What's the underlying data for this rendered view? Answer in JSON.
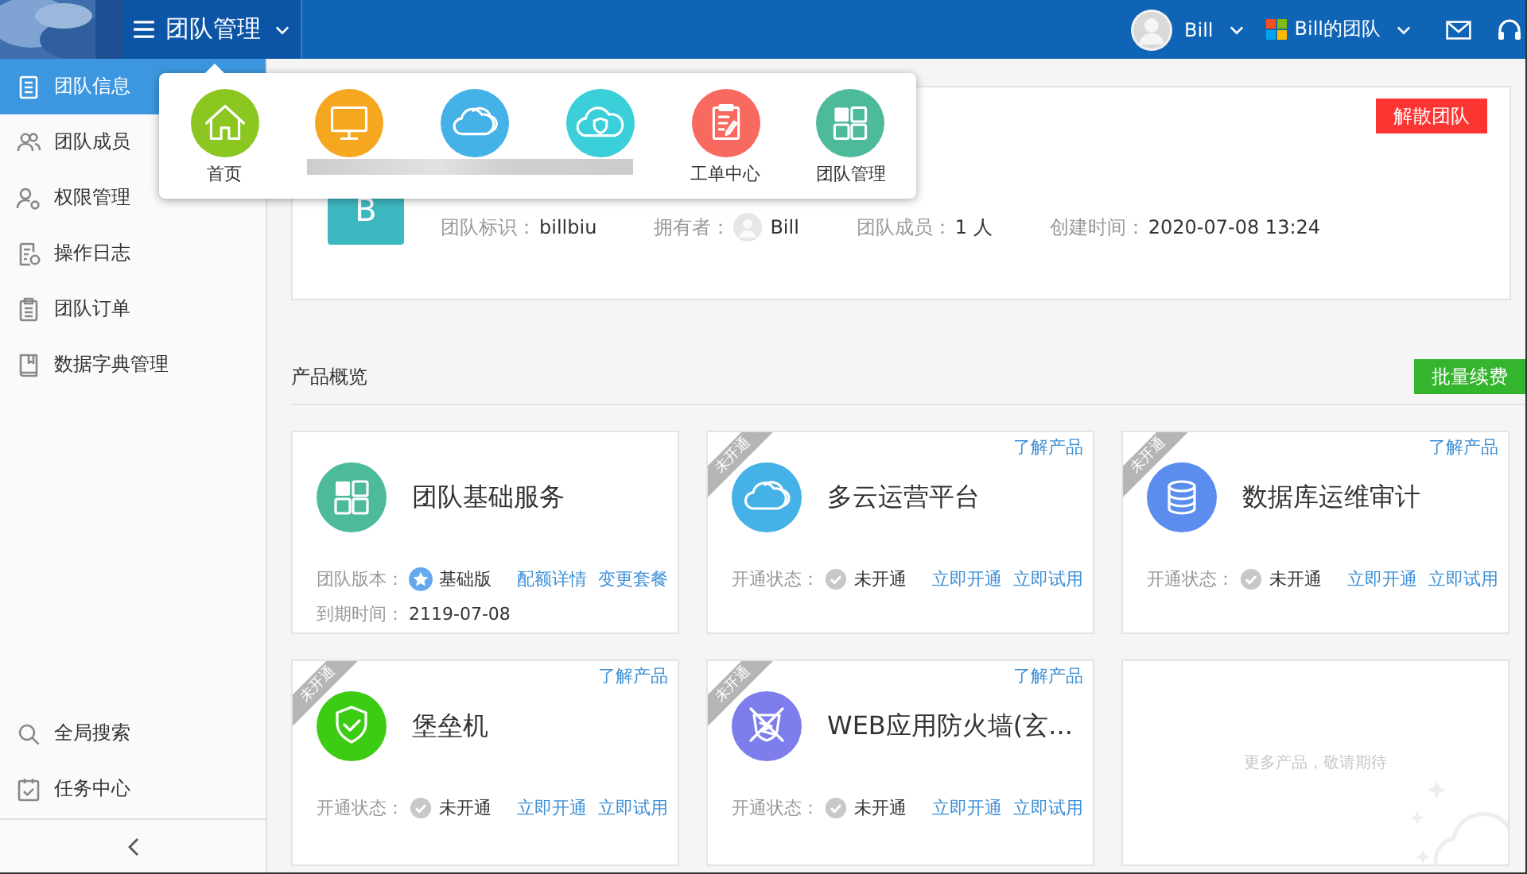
{
  "topbar": {
    "menu_title": "团队管理",
    "user": "Bill",
    "team": "Bill的团队"
  },
  "sidebar": {
    "items": [
      {
        "label": "团队信息",
        "selected": true
      },
      {
        "label": "团队成员",
        "selected": false
      },
      {
        "label": "权限管理",
        "selected": false
      },
      {
        "label": "操作日志",
        "selected": false
      },
      {
        "label": "团队订单",
        "selected": false
      },
      {
        "label": "数据字典管理",
        "selected": false
      }
    ],
    "bottom_items": [
      {
        "label": "全局搜索"
      },
      {
        "label": "任务中心"
      }
    ]
  },
  "app_menu": {
    "items": [
      {
        "label": "首页",
        "color": "#8cc621"
      },
      {
        "color": "#f5a71f"
      },
      {
        "color": "#44b2e6"
      },
      {
        "color": "#3bcfd9"
      },
      {
        "label": "工单中心",
        "color": "#f8695f"
      },
      {
        "label": "团队管理",
        "color": "#4dba9c"
      }
    ]
  },
  "team": {
    "avatar_letter": "B",
    "dissolve_button": "解散团队",
    "fields": [
      {
        "label": "团队标识：",
        "value": "billbiu"
      },
      {
        "label": "拥有者：",
        "value": "Bill",
        "kind": "user"
      },
      {
        "label": "团队成员：",
        "value": "1 人"
      },
      {
        "label": "创建时间：",
        "value": "2020-07-08 13:24"
      }
    ]
  },
  "products": {
    "title": "产品概览",
    "renew_button": "批量续费",
    "cards": [
      {
        "kind": "active",
        "name": "团队基础服务",
        "color": "#4dba9c",
        "rows": [
          {
            "label": "团队版本：",
            "value": "基础版",
            "badge": true,
            "links": [
              "配额详情",
              "变更套餐"
            ]
          },
          {
            "label": "到期时间：",
            "value": "2119-07-08"
          }
        ]
      },
      {
        "kind": "inactive",
        "name": "多云运营平台",
        "color": "#44b2e6",
        "ribbon": "未开通",
        "more_link": "了解产品",
        "rows": [
          {
            "label": "开通状态：",
            "value": "未开通",
            "links": [
              "立即开通",
              "立即试用"
            ]
          }
        ]
      },
      {
        "kind": "inactive",
        "name": "数据库运维审计",
        "color": "#5b8def",
        "ribbon": "未开通",
        "more_link": "了解产品",
        "rows": [
          {
            "label": "开通状态：",
            "value": "未开通",
            "links": [
              "立即开通",
              "立即试用"
            ]
          }
        ]
      },
      {
        "kind": "inactive",
        "name": "堡垒机",
        "color": "#3ccc14",
        "ribbon": "未开通",
        "more_link": "了解产品",
        "rows": [
          {
            "label": "开通状态：",
            "value": "未开通",
            "links": [
              "立即开通",
              "立即试用"
            ]
          }
        ]
      },
      {
        "kind": "inactive",
        "name": "WEB应用防火墙(玄...",
        "color": "#7d7deb",
        "ribbon": "未开通",
        "more_link": "了解产品",
        "rows": [
          {
            "label": "开通状态：",
            "value": "未开通",
            "links": [
              "立即开通",
              "立即试用"
            ]
          }
        ]
      },
      {
        "kind": "placeholder",
        "text": "更多产品，敬请期待"
      }
    ]
  }
}
